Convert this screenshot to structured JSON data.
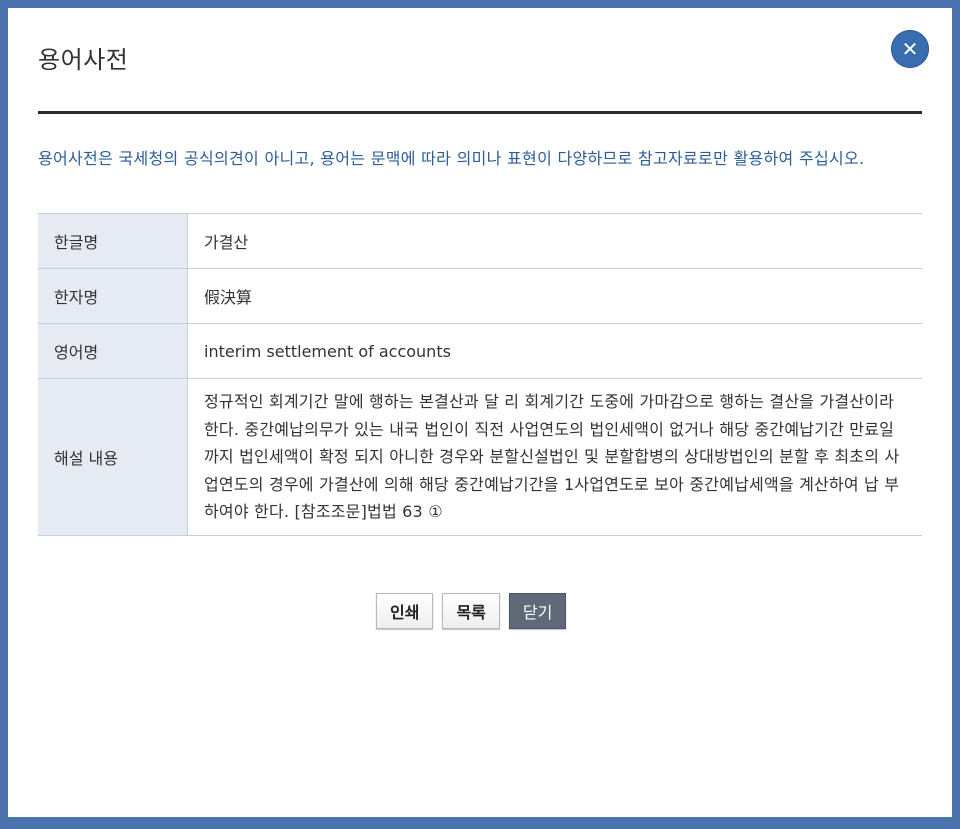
{
  "dialog": {
    "title": "용어사전",
    "close_icon": "close-icon",
    "notice": "용어사전은 국세청의 공식의견이 아니고, 용어는 문맥에 따라 의미나 표현이 다양하므로 참고자료로만 활용하여 주십시오."
  },
  "rows": [
    {
      "label": "한글명",
      "value": "가결산"
    },
    {
      "label": "한자명",
      "value": "假決算"
    },
    {
      "label": "영어명",
      "value": "interim settlement of accounts"
    },
    {
      "label": "해설 내용",
      "value": "정규적인 회계기간 말에 행하는 본결산과 달 리 회계기간 도중에 가마감으로 행하는 결산을 가결산이라 한다. 중간예납의무가 있는 내국 법인이 직전 사업연도의 법인세액이 없거나 해당 중간예납기간 만료일까지 법인세액이 확정 되지 아니한 경우와 분할신설법인 및 분할합병의 상대방법인의 분할 후 최초의 사업연도의 경우에 가결산에 의해 해당 중간예납기간을 1사업연도로 보아 중간예납세액을 계산하여 납 부하여야 한다. [참조조문]법법 63 ①"
    }
  ],
  "buttons": {
    "print": "인쇄",
    "list": "목록",
    "close": "닫기"
  },
  "colors": {
    "frame": "#4a73ad",
    "close_button": "#3a6db0",
    "notice_text": "#2c5c9a",
    "label_bg": "#e6ebf3",
    "close_btn_bg": "#5f6a78"
  }
}
